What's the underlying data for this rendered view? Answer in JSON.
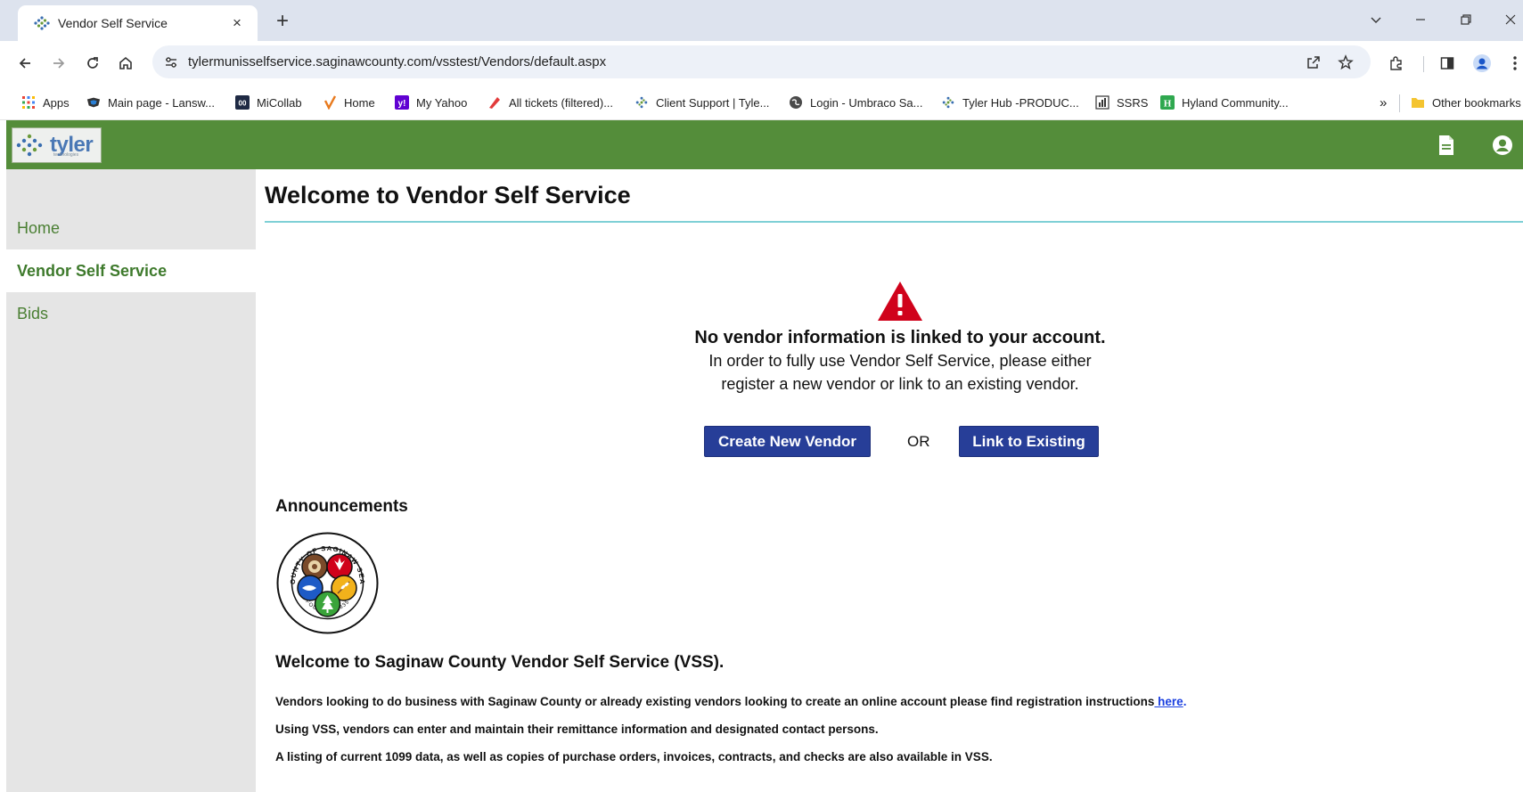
{
  "browser": {
    "tab_title": "Vendor Self Service",
    "tab_close": "×",
    "new_tab": "+",
    "url": "tylermunisselfservice.saginawcounty.com/vsstest/Vendors/default.aspx",
    "bookmarks": [
      {
        "label": "Apps",
        "icon": "apps-grid-icon"
      },
      {
        "label": "Main page - Lansw...",
        "icon": "lansweeper-icon"
      },
      {
        "label": "MiCollab",
        "icon": "micollab-icon"
      },
      {
        "label": "Home",
        "icon": "checkmark-icon"
      },
      {
        "label": "My Yahoo",
        "icon": "yahoo-icon"
      },
      {
        "label": "All tickets (filtered)...",
        "icon": "ticket-icon"
      },
      {
        "label": "Client Support | Tyle...",
        "icon": "tyler-icon"
      },
      {
        "label": "Login - Umbraco Sa...",
        "icon": "globe-icon"
      },
      {
        "label": "Tyler Hub -PRODUC...",
        "icon": "tyler-icon"
      },
      {
        "label": "SSRS",
        "icon": "report-icon"
      },
      {
        "label": "Hyland Community...",
        "icon": "hyland-icon"
      }
    ],
    "bookmarks_overflow": "»",
    "other_bookmarks": "Other bookmarks"
  },
  "app": {
    "logo_text": "tyler",
    "logo_subtext": "technologies"
  },
  "sidebar": {
    "items": [
      {
        "label": "Home",
        "active": false
      },
      {
        "label": "Vendor Self Service",
        "active": true
      },
      {
        "label": "Bids",
        "active": false
      }
    ]
  },
  "main": {
    "title": "Welcome to Vendor Self Service",
    "notice": {
      "heading": "No vendor information is linked to your account.",
      "line1": "In order to fully use Vendor Self Service, please either",
      "line2": "register a new vendor or link to an existing vendor."
    },
    "create_button": "Create New Vendor",
    "or_text": "OR",
    "link_button": "Link to Existing",
    "announcements": {
      "heading": "Announcements",
      "seal_text_top": "COUNTY OF SAGINAW SEAL",
      "seal_text_bottom": "FOUNDED 1835",
      "title": "Welcome to Saginaw County Vendor Self Service (VSS).",
      "p1_text": "Vendors looking to do business with Saginaw County or already existing vendors looking to create an online account please find registration instructions",
      "p1_link": " here",
      "p1_end": ".",
      "p2": "Using VSS, vendors can enter and maintain their remittance information and designated contact persons.",
      "p3": "A listing of current 1099 data, as well as copies of purchase orders, invoices, contracts, and checks are also available in VSS."
    }
  },
  "colors": {
    "appbar": "#548d3a",
    "button": "#273e98",
    "warning": "#d0021b",
    "link": "#1a3fe0",
    "title_rule": "#7fd0d6"
  }
}
